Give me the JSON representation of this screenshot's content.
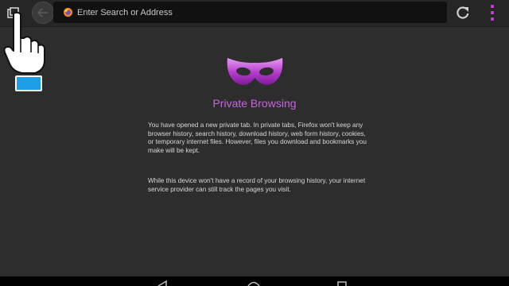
{
  "toolbar": {
    "tabs_icon": "tabs-icon",
    "back_icon": "back-arrow-icon",
    "urlbar": {
      "placeholder": "Enter Search or Address",
      "value": "",
      "icon": "globe-icon"
    },
    "reload_icon": "reload-icon",
    "menu_icon": "menu-dots-icon"
  },
  "private_page": {
    "icon": "mask-icon",
    "title": "Private Browsing",
    "paragraph1": "You have opened a new private tab. In private tabs, Firefox won't keep any browser history, search history, download history, web form history, cookies, or temporary internet files. However, files you download and bookmarks you make will be kept.",
    "paragraph2": "While this device won't have a record of your browsing history, your internet service provider can still track the pages you visit."
  },
  "navbar": {
    "back_icon": "nav-back-icon",
    "home_icon": "nav-home-icon",
    "recents_icon": "nav-recents-icon"
  },
  "overlay": {
    "pointer_icon": "pointing-hand-icon",
    "key_icon": "blue-key-icon"
  },
  "colors": {
    "accent": "#c566db",
    "menu_dots": "#c13fd0",
    "background": "#2d2d2d",
    "key_blue": "#1e9ee6"
  }
}
